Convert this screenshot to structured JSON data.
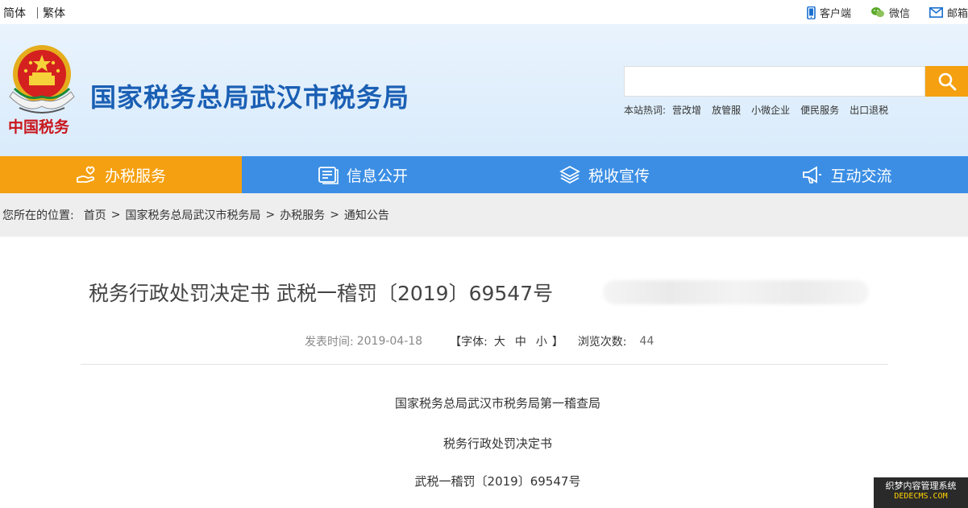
{
  "topbar": {
    "lang_simplified": "简体",
    "lang_traditional": "繁体",
    "links": [
      {
        "label": "客户端",
        "icon": "mobile-icon"
      },
      {
        "label": "微信",
        "icon": "wechat-icon"
      },
      {
        "label": "邮箱",
        "icon": "mail-icon"
      }
    ]
  },
  "header": {
    "seal_text": "中国税务",
    "site_title": "国家税务总局武汉市税务局",
    "search_placeholder": "",
    "hot_label": "本站热词:",
    "hot_words": [
      "营改增",
      "放管服",
      "小微企业",
      "便民服务",
      "出口退税"
    ]
  },
  "nav": {
    "items": [
      {
        "label": "办税服务",
        "icon": "hand-service-icon",
        "active": true
      },
      {
        "label": "信息公开",
        "icon": "document-icon",
        "active": false
      },
      {
        "label": "税收宣传",
        "icon": "layers-icon",
        "active": false
      },
      {
        "label": "互动交流",
        "icon": "megaphone-icon",
        "active": false
      }
    ]
  },
  "breadcrumb": {
    "prefix": "您所在的位置:",
    "items": [
      "首页",
      "国家税务总局武汉市税务局",
      "办税服务",
      "通知公告"
    ]
  },
  "article": {
    "title": "税务行政处罚决定书 武税一稽罚〔2019〕69547号",
    "pub_label": "发表时间:",
    "pub_date": "2019-04-18",
    "font_open": "【字体:",
    "font_large": "大",
    "font_medium": "中",
    "font_small": "小",
    "font_close": "】",
    "views_label": "浏览次数:",
    "views": "44",
    "paragraphs": [
      "国家税务总局武汉市税务局第一稽查局",
      "税务行政处罚决定书",
      "武税一稽罚〔2019〕69547号"
    ]
  },
  "watermark": {
    "line1": "织梦内容管理系统",
    "line2": "DEDECMS.COM"
  },
  "colors": {
    "accent_orange": "#f5a010",
    "nav_blue": "#3b8ee4",
    "title_blue": "#1a5fb4",
    "seal_red": "#c8161d"
  }
}
